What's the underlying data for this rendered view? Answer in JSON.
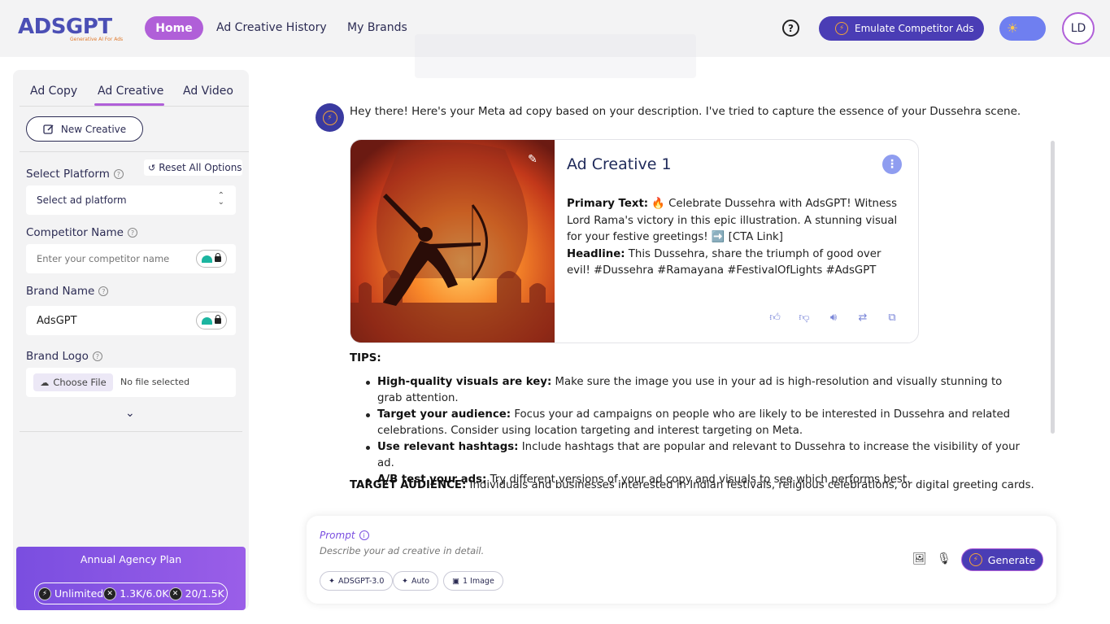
{
  "brand": {
    "logo_text": "ADSGPT",
    "logo_tagline": "Generative AI For Ads"
  },
  "nav": {
    "home": "Home",
    "history": "Ad Creative History",
    "brands": "My Brands",
    "help": "?",
    "emulate": "Emulate Competitor Ads",
    "avatar": "LD"
  },
  "sidebar": {
    "tabs": [
      "Ad Copy",
      "Ad Creative",
      "Ad Video"
    ],
    "active_tab": "Ad Creative",
    "new_creative": "New Creative",
    "reset": "Reset All Options",
    "platform_label": "Select Platform",
    "platform_value": "Select ad platform",
    "competitor_label": "Competitor Name",
    "competitor_placeholder": "Enter your competitor name",
    "brand_label": "Brand Name",
    "brand_value": "AdsGPT",
    "logo_label": "Brand Logo",
    "choose_file": "Choose File",
    "no_file": "No file selected",
    "plan": {
      "title": "Annual Agency Plan",
      "stats": [
        "Unlimited",
        "1.3K/6.0K",
        "20/1.5K"
      ]
    }
  },
  "chat": {
    "intro": "Hey there! Here's your Meta ad copy based on your description. I've tried to capture the essence of your Dussehra scene.",
    "card": {
      "title": "Ad Creative 1",
      "primary_label": "Primary Text:",
      "primary_text": " 🔥 Celebrate Dussehra with AdsGPT! Witness Lord Rama's victory in this epic illustration. A stunning visual for your festive greetings! ➡️ [CTA Link]",
      "headline_label": "Headline:",
      "headline_text": " This Dussehra, share the triumph of good over evil! #Dussehra #Ramayana #FestivalOfLights #AdsGPT"
    },
    "tips_label": "TIPS:",
    "tips": [
      {
        "bold": "High-quality visuals are key:",
        "text": " Make sure the image you use in your ad is high-resolution and visually stunning to grab attention."
      },
      {
        "bold": "Target your audience:",
        "text": " Focus your ad campaigns on people who are likely to be interested in Dussehra and related celebrations. Consider using location targeting and interest targeting on Meta."
      },
      {
        "bold": "Use relevant hashtags:",
        "text": " Include hashtags that are popular and relevant to Dussehra to increase the visibility of your ad."
      },
      {
        "bold": "A/B test your ads:",
        "text": " Try different versions of your ad copy and visuals to see which performs best."
      }
    ],
    "target_label": "TARGET AUDIENCE:",
    "target_text": " Individuals and businesses interested in Indian festivals, religious celebrations, or digital greeting cards."
  },
  "prompt": {
    "label": "Prompt",
    "placeholder": "Describe your ad creative in detail.",
    "chips": [
      "ADSGPT-3.0",
      "Auto",
      "1 Image"
    ],
    "generate": "Generate"
  },
  "colors": {
    "accent_purple": "#b05fd8",
    "primary_indigo": "#4a3db5",
    "plan_gradient": "#7a4ee0"
  }
}
